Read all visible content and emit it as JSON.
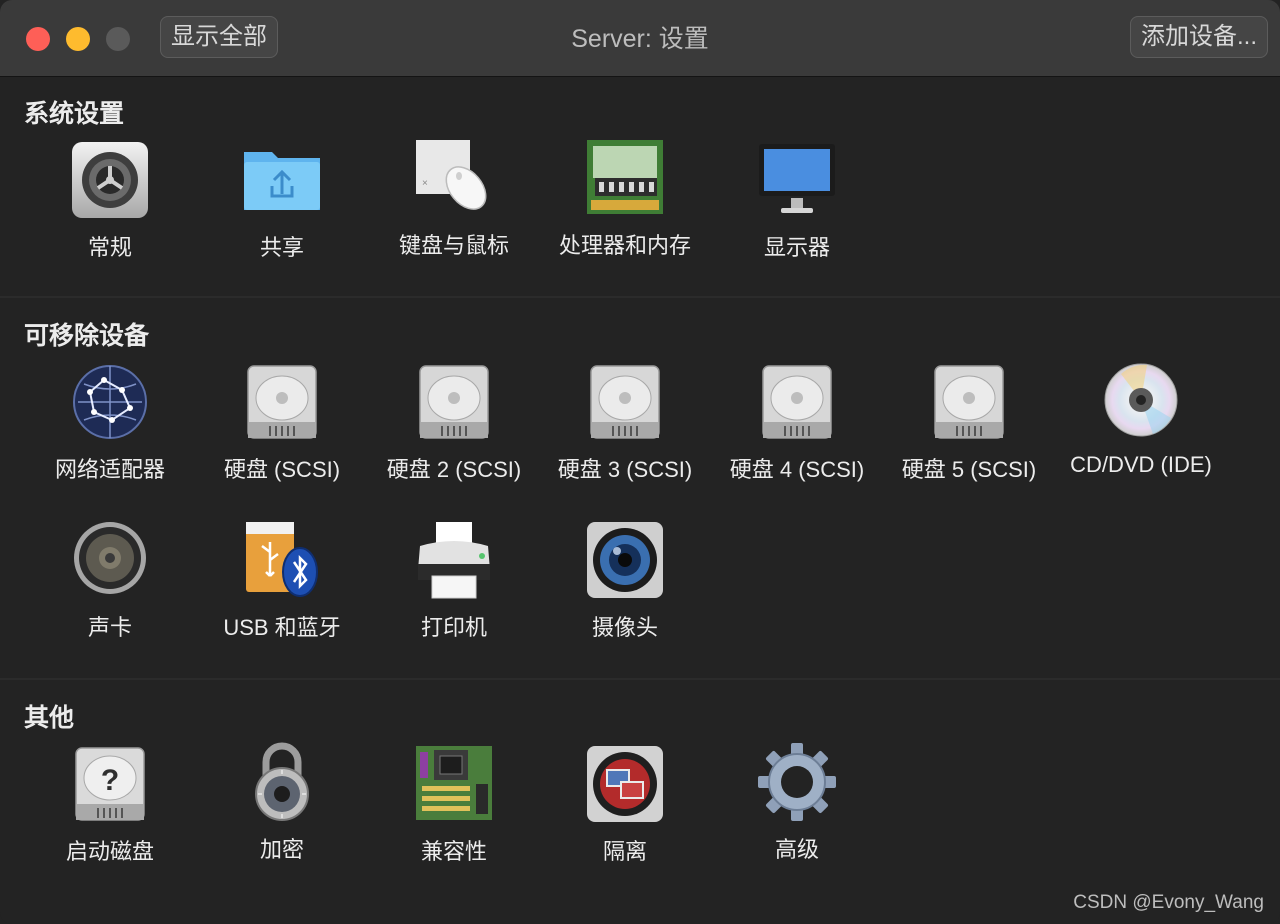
{
  "window": {
    "title": "Server: 设置",
    "show_all_label": "显示全部",
    "add_device_label": "添加设备..."
  },
  "sections": {
    "system": {
      "heading": "系统设置",
      "items": [
        {
          "label": "常规",
          "icon": "gear-icon"
        },
        {
          "label": "共享",
          "icon": "shared-folder-icon"
        },
        {
          "label": "键盘与鼠标",
          "icon": "keyboard-mouse-icon"
        },
        {
          "label": "处理器和内存",
          "icon": "memory-chip-icon"
        },
        {
          "label": "显示器",
          "icon": "display-icon"
        }
      ]
    },
    "removable": {
      "heading": "可移除设备",
      "items": [
        {
          "label": "网络适配器",
          "icon": "network-globe-icon"
        },
        {
          "label": "硬盘 (SCSI)",
          "icon": "hard-disk-icon"
        },
        {
          "label": "硬盘 2 (SCSI)",
          "icon": "hard-disk-icon"
        },
        {
          "label": "硬盘 3 (SCSI)",
          "icon": "hard-disk-icon"
        },
        {
          "label": "硬盘 4 (SCSI)",
          "icon": "hard-disk-icon"
        },
        {
          "label": "硬盘 5 (SCSI)",
          "icon": "hard-disk-icon"
        },
        {
          "label": "CD/DVD (IDE)",
          "icon": "cd-dvd-icon"
        },
        {
          "label": "声卡",
          "icon": "speaker-icon"
        },
        {
          "label": "USB 和蓝牙",
          "icon": "usb-bluetooth-icon"
        },
        {
          "label": "打印机",
          "icon": "printer-icon"
        },
        {
          "label": "摄像头",
          "icon": "camera-icon"
        }
      ]
    },
    "other": {
      "heading": "其他",
      "items": [
        {
          "label": "启动磁盘",
          "icon": "startup-disk-icon"
        },
        {
          "label": "加密",
          "icon": "padlock-icon"
        },
        {
          "label": "兼容性",
          "icon": "motherboard-icon"
        },
        {
          "label": "隔离",
          "icon": "isolation-icon"
        },
        {
          "label": "高级",
          "icon": "advanced-gear-icon"
        }
      ]
    }
  },
  "watermark": "CSDN @Evony_Wang",
  "colors": {
    "background": "#232323",
    "titlebar": "#3a3a3a",
    "close": "#fe5f57",
    "minimize": "#febb2e"
  }
}
